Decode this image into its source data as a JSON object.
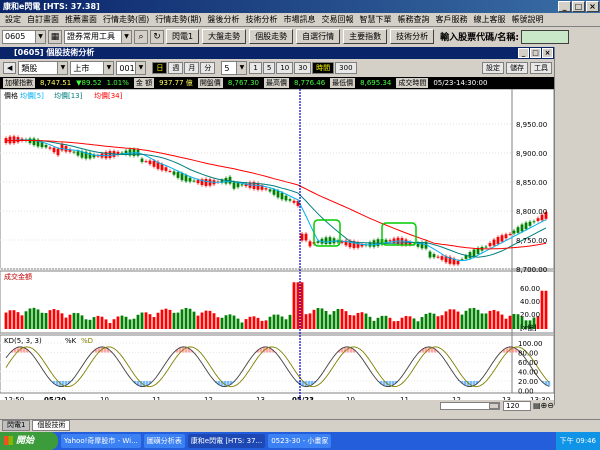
{
  "window": {
    "title": "康和e閃電 [HTS: 37.38]"
  },
  "menu": [
    "設定",
    "自訂畫面",
    "推薦畫面",
    "行情走勢(國)",
    "行情走勢(期)",
    "盤後分析",
    "技術分析",
    "市場訊息",
    "交易回報",
    "智慧下單",
    "帳務查詢",
    "客戶服務",
    "線上客服",
    "帳號說明"
  ],
  "toolbar": {
    "code": "0605",
    "tool_combo": "證券常用工具",
    "buttons": [
      "閃電1",
      "大盤走勢",
      "個股走勢",
      "自選行情",
      "主要指數",
      "技術分析"
    ],
    "stock_label": "輸入股票代碼/名稱:"
  },
  "subwindow": {
    "title": "[0605] 個股技術分析"
  },
  "controls": {
    "type": "類股",
    "market": "上市",
    "code": "001",
    "periods": [
      "日",
      "週",
      "月",
      "分"
    ],
    "interval": "5",
    "mins": [
      "1",
      "5",
      "10",
      "30",
      "時間",
      "300"
    ],
    "right": [
      "設定",
      "儲存",
      "工具"
    ]
  },
  "info": {
    "name": "加權指數",
    "price": "8,747.51",
    "change": "▼89.52",
    "pct": "1.01%",
    "amount_label": "金 額",
    "amount": "937.77 億",
    "open_label": "開盤價",
    "open": "8,767.30",
    "high_label": "最高價",
    "high": "8,776.46",
    "low_label": "最低價",
    "low": "8,695.34",
    "time_label": "成交時間",
    "time": "05/23-14:30:00"
  },
  "panels": {
    "price": {
      "legend": [
        "價格",
        "均價[5]",
        "均價[13]",
        "均價[34]"
      ],
      "ticks": [
        "8,950.00",
        "8,900.00",
        "8,850.00",
        "8,800.00",
        "8,750.00",
        "8,700.00"
      ]
    },
    "volume": {
      "legend": "成交金額",
      "ticks": [
        "60.00",
        "40.00",
        "20.00",
        "[x億]"
      ]
    },
    "kd": {
      "legend": [
        "KD(5, 3, 3)",
        "%K",
        "%D"
      ],
      "ticks": [
        "100.00",
        "80.00",
        "60.00",
        "40.00",
        "20.00",
        "0.00"
      ]
    },
    "xaxis": [
      "12:50",
      "05/20",
      "10",
      "11",
      "12",
      "13",
      "05/23",
      "10",
      "11",
      "12",
      "13",
      "13:30"
    ],
    "zoom": "120"
  },
  "colors": {
    "up": "#ff0000",
    "down": "#008000",
    "ma5": "#00b0f0",
    "ma13": "#008080",
    "ma34": "#ff0000",
    "k": "#404040",
    "d": "#808000",
    "cursor": "#0000cc"
  },
  "tabs": [
    "閃電1",
    "個股技術"
  ],
  "taskbar": {
    "start": "開始",
    "items": [
      "Yahoo!奇摩股市 - Wi...",
      "圖磺分析表",
      "康和e閃電 [HTS: 37...",
      "0523-30 - 小畫家"
    ],
    "time": "下午 09:46"
  }
}
